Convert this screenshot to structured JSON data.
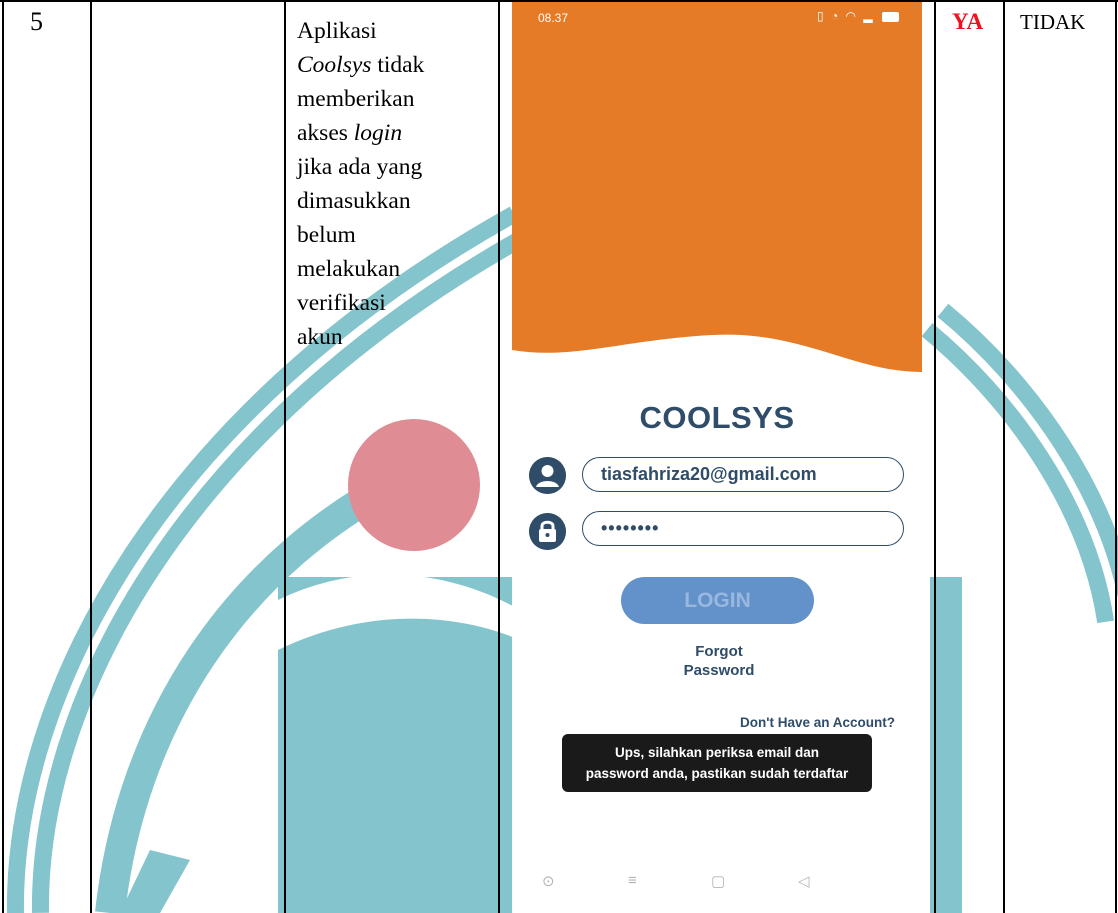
{
  "table_row": {
    "number": "5",
    "description_lines": [
      {
        "pre": "Aplikasi",
        "em": "",
        "post": ""
      },
      {
        "pre": "",
        "em": "Coolsys",
        "post": " tidak"
      },
      {
        "pre": "memberikan",
        "em": "",
        "post": ""
      },
      {
        "pre": "akses ",
        "em": "login",
        "post": ""
      },
      {
        "pre": "jika ada yang",
        "em": "",
        "post": ""
      },
      {
        "pre": "dimasukkan",
        "em": "",
        "post": ""
      },
      {
        "pre": "belum",
        "em": "",
        "post": ""
      },
      {
        "pre": "melakukan",
        "em": "",
        "post": ""
      },
      {
        "pre": "verifikasi",
        "em": "",
        "post": ""
      },
      {
        "pre": "akun",
        "em": "",
        "post": ""
      }
    ],
    "yes_label": "YA",
    "no_label": "TIDAK"
  },
  "phone": {
    "status_time": "08.37",
    "app_title": "COOLSYS",
    "email_value": "tiasfahriza20@gmail.com",
    "password_value": "••••••••",
    "login_label": "LOGIN",
    "forgot_line1": "Forgot",
    "forgot_line2": "Password",
    "signup_label": "Don't Have an Account?",
    "toast_line1": "Ups, silahkan periksa email dan",
    "toast_line2": "password anda, pastikan sudah terdaftar",
    "nav_icons": [
      "circle-home-icon",
      "menu-icon",
      "square-recents-icon",
      "back-triangle-icon"
    ],
    "colors": {
      "header": "#e57b27",
      "primary": "#2f4c68",
      "button": "#6391c9",
      "toast": "#1a1a1a"
    }
  },
  "colors": {
    "yes_label": "#e8141e",
    "watermark_teal": "#84c4cc",
    "watermark_pink": "#e08c94"
  }
}
